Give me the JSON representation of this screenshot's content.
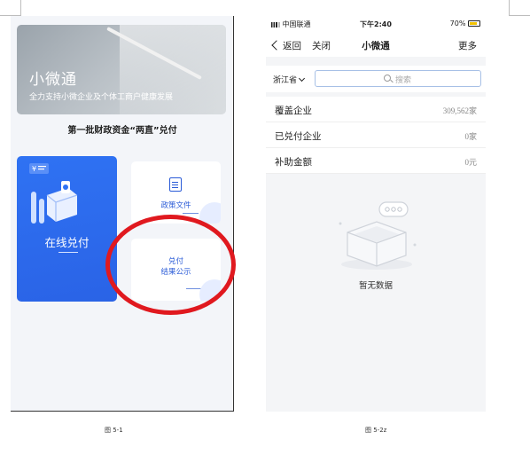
{
  "left": {
    "banner": {
      "title": "小微通",
      "subtitle": "全力支持小微企业及个体工商户健康发展"
    },
    "section_title": "第一批财政资金“两直”兑付",
    "cards": {
      "online_payment": "在线兑付",
      "policy_docs": "政策文件",
      "results_line1": "兑付",
      "results_line2": "结果公示"
    },
    "caption": "图 5-1"
  },
  "right": {
    "status": {
      "carrier": "中国联通",
      "time": "下午2:40",
      "battery": "70%"
    },
    "nav": {
      "back": "返回",
      "close": "关闭",
      "title": "小微通",
      "more": "更多"
    },
    "filter": {
      "province": "浙江省",
      "search_placeholder": "搜索"
    },
    "stats": [
      {
        "label": "覆盖企业",
        "value": "309,562家"
      },
      {
        "label": "已兑付企业",
        "value": "0家"
      },
      {
        "label": "补助金额",
        "value": "0元"
      }
    ],
    "empty_text": "暂无数据",
    "caption": "图 5-2z"
  },
  "colors": {
    "primary_blue": "#2f72f3",
    "highlight_red": "#e0191f"
  }
}
